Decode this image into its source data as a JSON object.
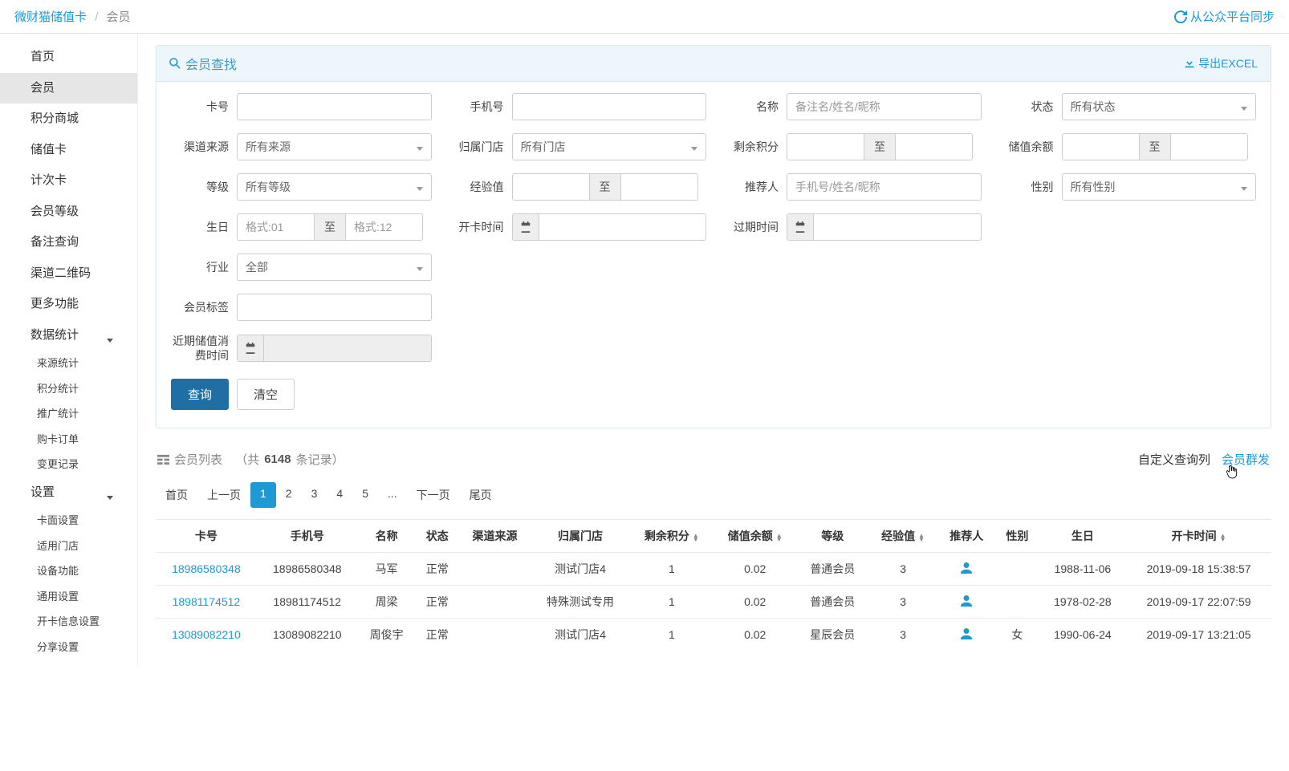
{
  "breadcrumb": {
    "root": "微财猫储值卡",
    "current": "会员"
  },
  "sync": "从公众平台同步",
  "sidebar": {
    "items": [
      "首页",
      "会员",
      "积分商城",
      "储值卡",
      "计次卡",
      "会员等级",
      "备注查询",
      "渠道二维码",
      "更多功能"
    ],
    "stats": {
      "title": "数据统计",
      "items": [
        "来源统计",
        "积分统计",
        "推广统计",
        "购卡订单",
        "变更记录"
      ]
    },
    "settings": {
      "title": "设置",
      "items": [
        "卡面设置",
        "适用门店",
        "设备功能",
        "通用设置",
        "开卡信息设置",
        "分享设置"
      ]
    }
  },
  "search": {
    "title": "会员查找",
    "export": "导出EXCEL",
    "fields": {
      "card_no": "卡号",
      "phone": "手机号",
      "name": "名称",
      "name_ph": "备注名/姓名/昵称",
      "status": "状态",
      "status_val": "所有状态",
      "channel": "渠道来源",
      "channel_val": "所有来源",
      "store": "归属门店",
      "store_val": "所有门店",
      "points": "剩余积分",
      "to": "至",
      "balance": "储值余额",
      "grade": "等级",
      "grade_val": "所有等级",
      "exp": "经验值",
      "referrer": "推荐人",
      "referrer_ph": "手机号/姓名/昵称",
      "gender": "性别",
      "gender_val": "所有性别",
      "birthday": "生日",
      "birthday_from_ph": "格式:01",
      "birthday_to_ph": "格式:12",
      "open_time": "开卡时间",
      "expire_time": "过期时间",
      "industry": "行业",
      "industry_val": "全部",
      "tags": "会员标签",
      "recent": "近期储值消费时间"
    },
    "btn_search": "查询",
    "btn_clear": "清空"
  },
  "list": {
    "title_prefix": "会员列表",
    "total_prefix": "（共",
    "total": "6148",
    "total_suffix": " 条记录）",
    "custom_cols": "自定义查询列",
    "mass_send": "会员群发",
    "pager": {
      "first": "首页",
      "prev": "上一页",
      "pages": [
        "1",
        "2",
        "3",
        "4",
        "5",
        "..."
      ],
      "next": "下一页",
      "last": "尾页"
    },
    "columns": [
      "卡号",
      "手机号",
      "名称",
      "状态",
      "渠道来源",
      "归属门店",
      "剩余积分",
      "储值余额",
      "等级",
      "经验值",
      "推荐人",
      "性别",
      "生日",
      "开卡时间"
    ],
    "rows": [
      {
        "card": "18986580348",
        "phone": "18986580348",
        "name": "马军",
        "status": "正常",
        "channel": "",
        "store": "测试门店4",
        "points": "1",
        "balance": "0.02",
        "grade": "普通会员",
        "exp": "3",
        "ref_icon": true,
        "gender": "",
        "birthday": "1988-11-06",
        "open": "2019-09-18 15:38:57"
      },
      {
        "card": "18981174512",
        "phone": "18981174512",
        "name": "周梁",
        "status": "正常",
        "channel": "",
        "store": "特殊测试专用",
        "points": "1",
        "balance": "0.02",
        "grade": "普通会员",
        "exp": "3",
        "ref_icon": true,
        "gender": "",
        "birthday": "1978-02-28",
        "open": "2019-09-17 22:07:59"
      },
      {
        "card": "13089082210",
        "phone": "13089082210",
        "name": "周俊宇",
        "status": "正常",
        "channel": "",
        "store": "测试门店4",
        "points": "1",
        "balance": "0.02",
        "grade": "星辰会员",
        "exp": "3",
        "ref_icon": true,
        "gender": "女",
        "birthday": "1990-06-24",
        "open": "2019-09-17 13:21:05"
      }
    ]
  }
}
